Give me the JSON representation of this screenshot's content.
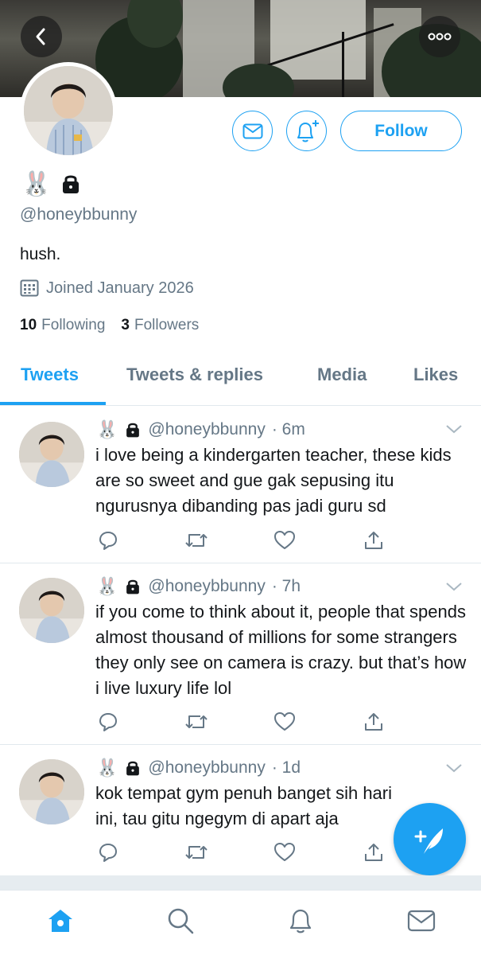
{
  "header": {
    "back_icon": "chevron-left-icon",
    "more_icon": "ellipsis-icon"
  },
  "profile": {
    "display_name_emoji": "🐰",
    "locked_icon": "lock-icon",
    "handle": "@honeybbunny",
    "bio": "hush.",
    "joined": "Joined January 2026",
    "following_count": "10",
    "following_label": "Following",
    "followers_count": "3",
    "followers_label": "Followers",
    "follow_label": "Follow"
  },
  "tabs": [
    {
      "label": "Tweets",
      "active": true
    },
    {
      "label": "Tweets & replies",
      "active": false
    },
    {
      "label": "Media",
      "active": false
    },
    {
      "label": "Likes",
      "active": false
    }
  ],
  "tweets": [
    {
      "emoji": "🐰",
      "handle": "@honeybbunny",
      "time": "· 6m",
      "text": "i love being a kindergarten teacher, these kids are so sweet and gue gak sepusing itu ngurusnya dibanding pas jadi guru sd"
    },
    {
      "emoji": "🐰",
      "handle": "@honeybbunny",
      "time": "· 7h",
      "text": "if you come to think about it, people that spends almost thousand of millions for some strangers they only see on camera is crazy. but that’s how i live luxury life lol"
    },
    {
      "emoji": "🐰",
      "handle": "@honeybbunny",
      "time": "· 1d",
      "text": "kok tempat gym penuh banget sih hari ini, tau gitu ngegym di apart aja"
    }
  ],
  "colors": {
    "accent": "#1da1f2",
    "secondary_text": "#657786",
    "divider": "#e1e8ed"
  }
}
